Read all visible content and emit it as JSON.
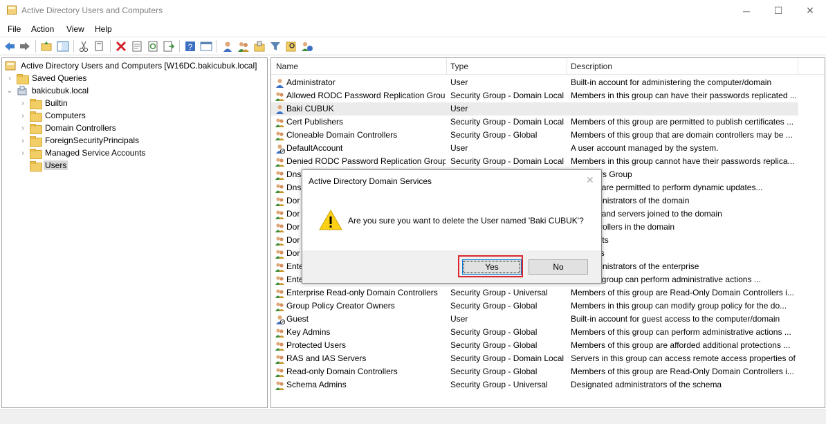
{
  "window": {
    "title": "Active Directory Users and Computers",
    "min_glyph": "─",
    "max_glyph": "☐",
    "close_glyph": "✕"
  },
  "menu": [
    "File",
    "Action",
    "View",
    "Help"
  ],
  "toolbar_icons": [
    "back-icon",
    "forward-icon",
    "up-folder-icon",
    "show-console-tree-icon",
    "cut-icon",
    "copy-icon",
    "delete-icon",
    "properties-icon",
    "refresh-icon",
    "export-list-icon",
    "help-icon",
    "console-view-icon",
    "new-user-icon",
    "new-group-icon",
    "new-ou-icon",
    "filter-icon",
    "find-icon",
    "add-to-group-icon"
  ],
  "tree": {
    "root": "Active Directory Users and Computers [W16DC.bakicubuk.local]",
    "saved_queries": "Saved Queries",
    "domain": "bakicubuk.local",
    "children": [
      "Builtin",
      "Computers",
      "Domain Controllers",
      "ForeignSecurityPrincipals",
      "Managed Service Accounts",
      "Users"
    ],
    "selected": "Users"
  },
  "list": {
    "columns": {
      "name": "Name",
      "type": "Type",
      "description": "Description"
    },
    "rows": [
      {
        "name": "Administrator",
        "type": "User",
        "desc": "Built-in account for administering the computer/domain",
        "icon": "user"
      },
      {
        "name": "Allowed RODC Password Replication Group",
        "type": "Security Group - Domain Local",
        "desc": "Members in this group can have their passwords replicated ...",
        "icon": "group"
      },
      {
        "name": "Baki CUBUK",
        "type": "User",
        "desc": "",
        "icon": "user"
      },
      {
        "name": "Cert Publishers",
        "type": "Security Group - Domain Local",
        "desc": "Members of this group are permitted to publish certificates ...",
        "icon": "group"
      },
      {
        "name": "Cloneable Domain Controllers",
        "type": "Security Group - Global",
        "desc": "Members of this group that are domain controllers may be ...",
        "icon": "group"
      },
      {
        "name": "DefaultAccount",
        "type": "User",
        "desc": "A user account managed by the system.",
        "icon": "user-disabled"
      },
      {
        "name": "Denied RODC Password Replication Group",
        "type": "Security Group - Domain Local",
        "desc": "Members in this group cannot have their passwords replica...",
        "icon": "group"
      },
      {
        "name": "Dns",
        "type": "",
        "desc": "inistrators Group",
        "icon": "group"
      },
      {
        "name": "Dns",
        "type": "",
        "desc": "nts who are permitted to perform dynamic updates...",
        "icon": "group"
      },
      {
        "name": "Dor",
        "type": "",
        "desc": "ted administrators of the domain",
        "icon": "group"
      },
      {
        "name": "Dor",
        "type": "",
        "desc": "stations and servers joined to the domain",
        "icon": "group"
      },
      {
        "name": "Dor",
        "type": "",
        "desc": "ain controllers in the domain",
        "icon": "group"
      },
      {
        "name": "Dor",
        "type": "",
        "desc": "ain guests",
        "icon": "group"
      },
      {
        "name": "Dor",
        "type": "",
        "desc": "ain users",
        "icon": "group"
      },
      {
        "name": "Ente",
        "type": "",
        "desc": "ted administrators of the enterprise",
        "icon": "group"
      },
      {
        "name": "Ente",
        "type": "",
        "desc": "s of this group can perform administrative actions ...",
        "icon": "group"
      },
      {
        "name": "Enterprise Read-only Domain Controllers",
        "type": "Security Group - Universal",
        "desc": "Members of this group are Read-Only Domain Controllers i...",
        "icon": "group"
      },
      {
        "name": "Group Policy Creator Owners",
        "type": "Security Group - Global",
        "desc": "Members in this group can modify group policy for the do...",
        "icon": "group"
      },
      {
        "name": "Guest",
        "type": "User",
        "desc": "Built-in account for guest access to the computer/domain",
        "icon": "user-disabled"
      },
      {
        "name": "Key Admins",
        "type": "Security Group - Global",
        "desc": "Members of this group can perform administrative actions ...",
        "icon": "group"
      },
      {
        "name": "Protected Users",
        "type": "Security Group - Global",
        "desc": "Members of this group are afforded additional protections ...",
        "icon": "group"
      },
      {
        "name": "RAS and IAS Servers",
        "type": "Security Group - Domain Local",
        "desc": "Servers in this group can access remote access properties of...",
        "icon": "group"
      },
      {
        "name": "Read-only Domain Controllers",
        "type": "Security Group - Global",
        "desc": "Members of this group are Read-Only Domain Controllers i...",
        "icon": "group"
      },
      {
        "name": "Schema Admins",
        "type": "Security Group - Universal",
        "desc": "Designated administrators of the schema",
        "icon": "group"
      }
    ]
  },
  "dialog": {
    "title": "Active Directory Domain Services",
    "close_glyph": "✕",
    "message": "Are you sure you want to delete the User named 'Baki CUBUK'?",
    "yes_label": "Yes",
    "no_label": "No"
  },
  "colors": {
    "highlight_border": "#d9262e",
    "accent": "#0078d7"
  }
}
